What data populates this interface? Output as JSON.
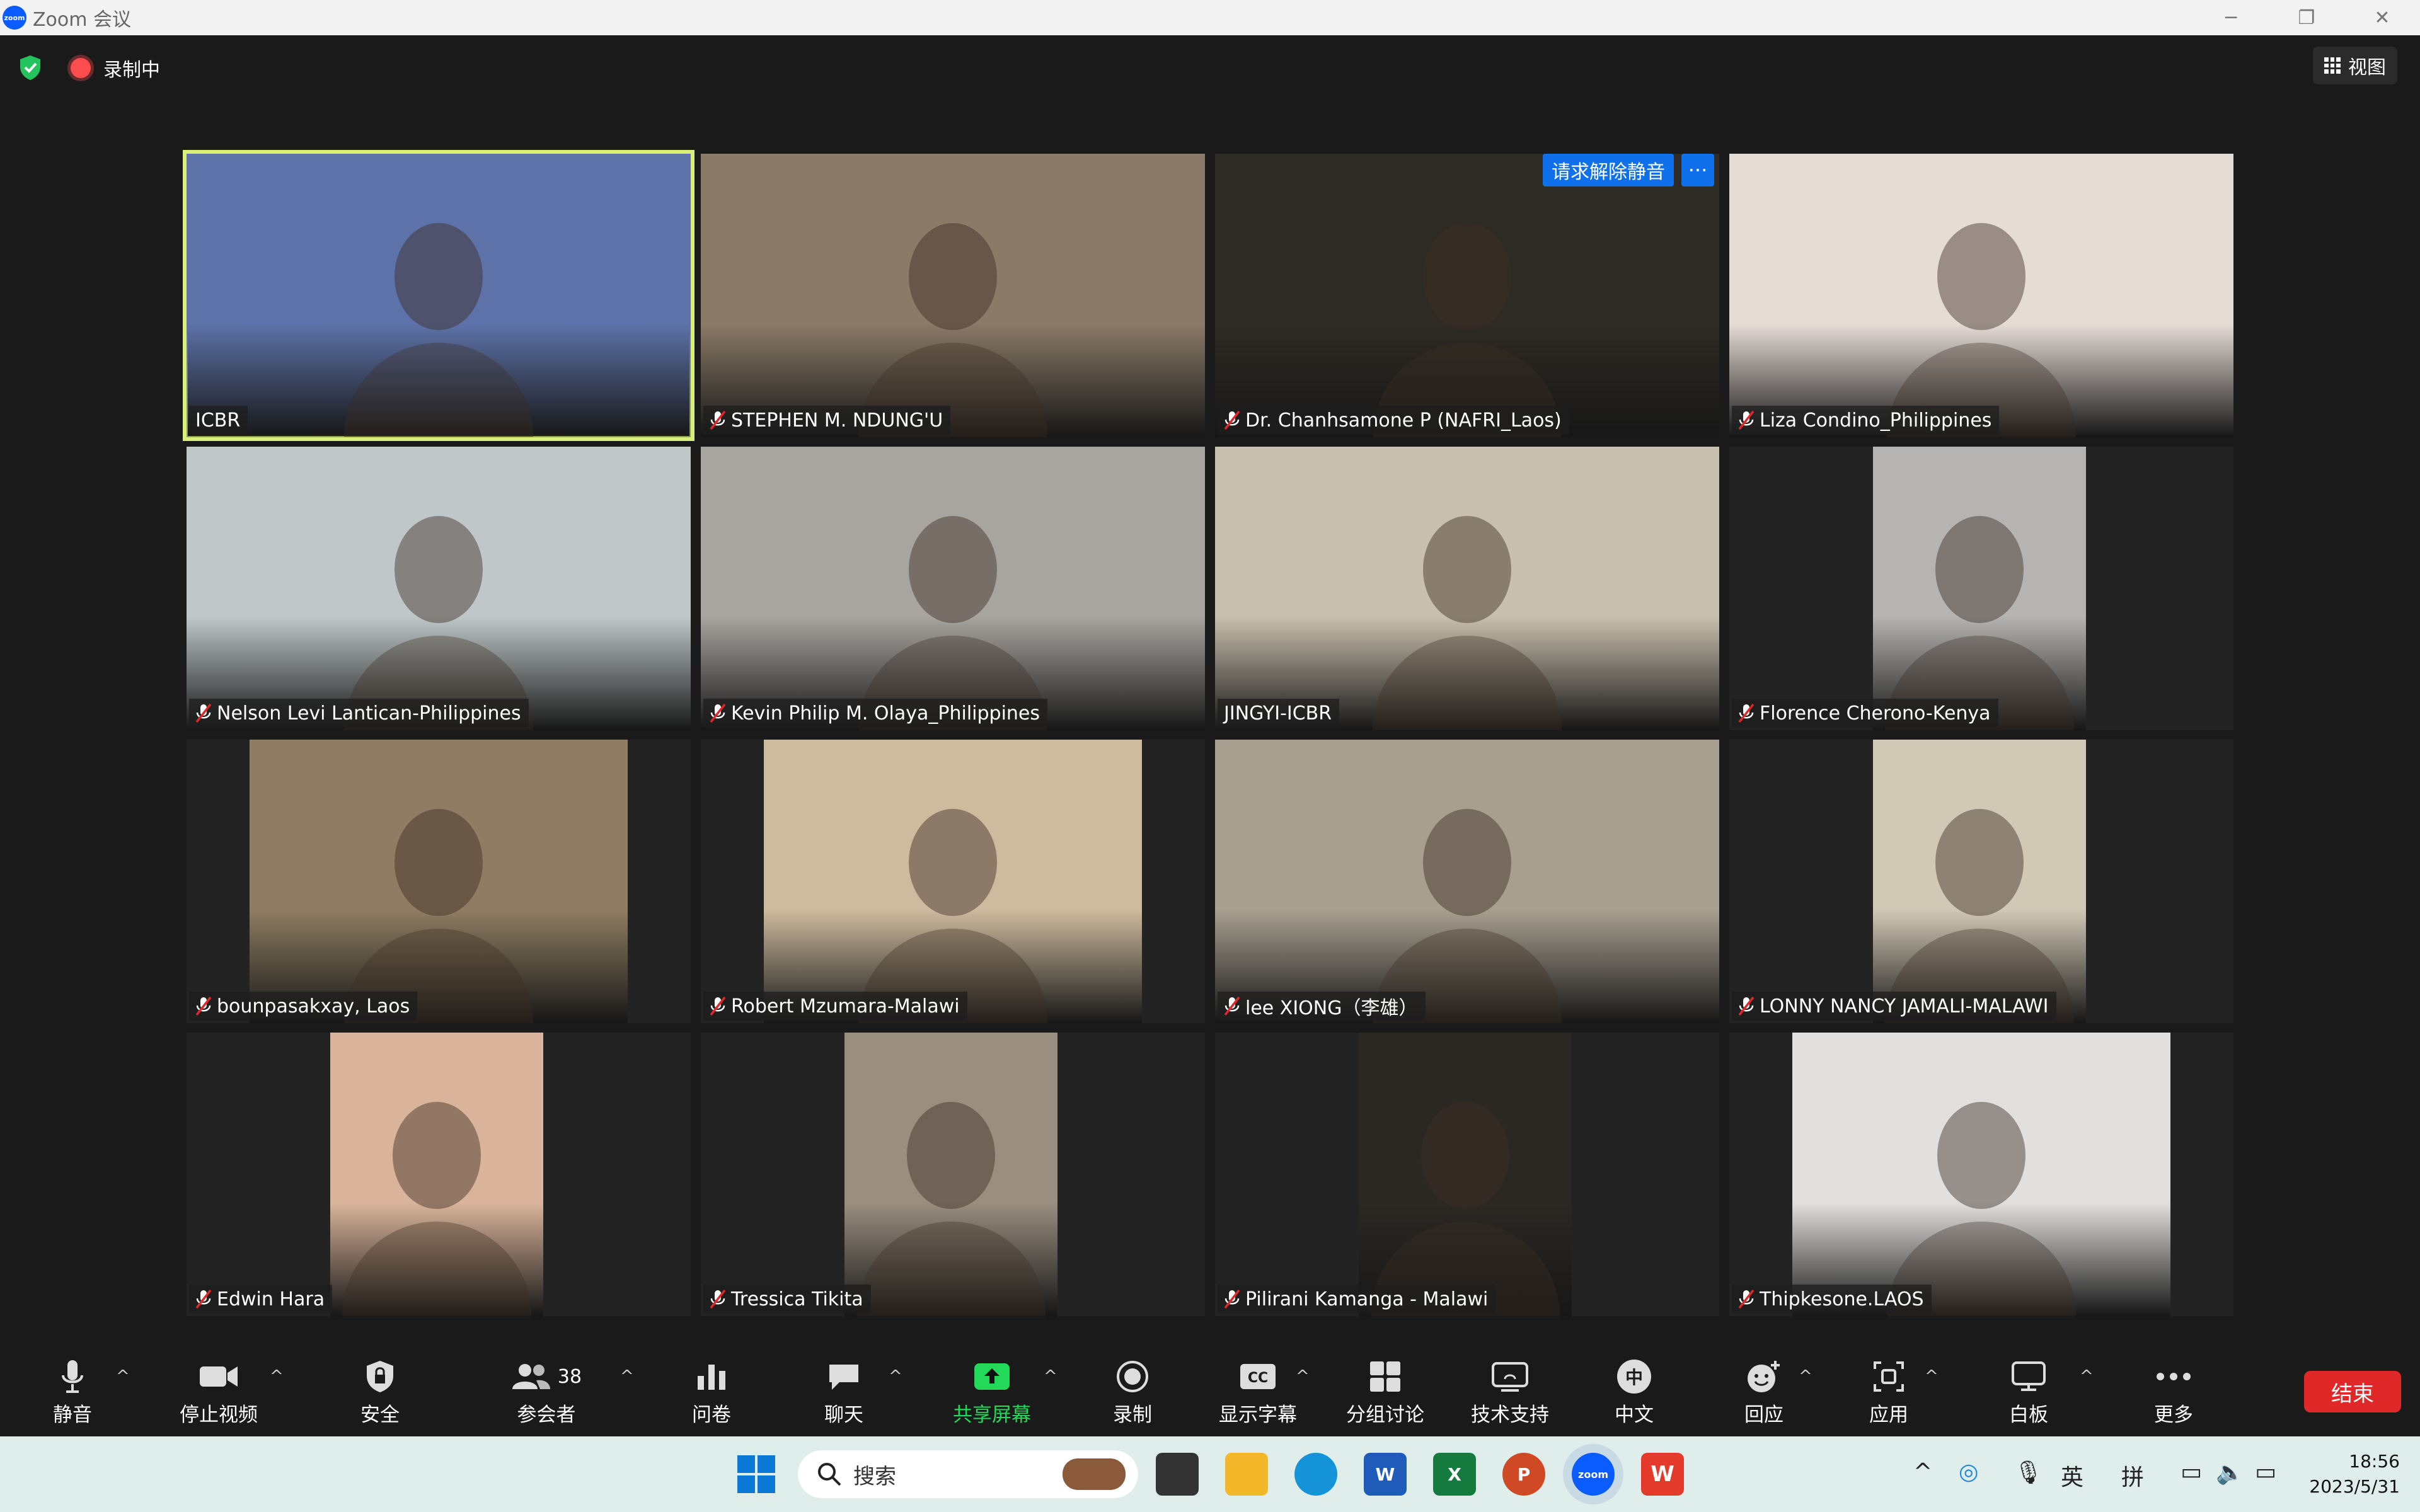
{
  "window": {
    "title": "Zoom 会议",
    "app_icon_text": "zoom",
    "controls": [
      "─",
      "❐",
      "✕"
    ]
  },
  "topbar": {
    "recording_label": "录制中",
    "view_label": "视图"
  },
  "request_unmute": {
    "label": "请求解除静音",
    "more": "···"
  },
  "participants": [
    {
      "name": "ICBR",
      "muted": false,
      "active": true,
      "bg": "#5d72a8"
    },
    {
      "name": "STEPHEN M. NDUNG'U",
      "muted": true,
      "bg": "#8a7a68"
    },
    {
      "name": "Dr. Chanhsamone P (NAFRI_Laos)",
      "muted": true,
      "bg": "#2e2a24"
    },
    {
      "name": "Liza Condino_Philippines",
      "muted": true,
      "bg": "#e6dcd6"
    },
    {
      "name": "Nelson Levi Lantican-Philippines",
      "muted": true,
      "bg": "#bfc7c8"
    },
    {
      "name": "Kevin Philip M. Olaya_Philippines",
      "muted": true,
      "bg": "#a8a4a0"
    },
    {
      "name": "JINGYI-ICBR",
      "muted": false,
      "bg": "#c9bfae"
    },
    {
      "name": "Florence Cherono-Kenya",
      "muted": true,
      "bg": "#b6b4b2"
    },
    {
      "name": "bounpasakxay, Laos",
      "muted": true,
      "bg": "#8e7d62"
    },
    {
      "name": "Robert Mzumara-Malawi",
      "muted": true,
      "bg": "#cdbb9e"
    },
    {
      "name": "lee XIONG（李雄）",
      "muted": true,
      "bg": "#a89f90"
    },
    {
      "name": "LONNY NANCY JAMALI-MALAWI",
      "muted": true,
      "bg": "#d2c8b6"
    },
    {
      "name": "Edwin Hara",
      "muted": true,
      "bg": "#d9b49a"
    },
    {
      "name": "Tressica Tikita",
      "muted": true,
      "bg": "#9a8e80"
    },
    {
      "name": "Pilirani Kamanga - Malawi",
      "muted": true,
      "bg": "#2b2824"
    },
    {
      "name": "Thipkesone.LAOS",
      "muted": true,
      "bg": "#e2e0de"
    }
  ],
  "toolbar": {
    "mute": "静音",
    "stop_video": "停止视频",
    "security": "安全",
    "participants": "参会者",
    "participants_count": "38",
    "polls": "问卷",
    "chat": "聊天",
    "share_screen": "共享屏幕",
    "record": "录制",
    "captions": "显示字幕",
    "breakout": "分组讨论",
    "support": "技术支持",
    "language": "中文",
    "language_icon": "中",
    "reactions": "回应",
    "apps": "应用",
    "whiteboard": "白板",
    "more": "更多",
    "end": "结束",
    "cc_icon": "CC"
  },
  "taskbar": {
    "search_placeholder": "搜索",
    "ime_lang": "英",
    "ime_mode": "拼",
    "time": "18:56",
    "date": "2023/5/31",
    "apps": [
      "W",
      "X",
      "P",
      "zoom",
      "W"
    ]
  },
  "colors": {
    "active_speaker": "#d8f07a",
    "share_green": "#23d959",
    "end_red": "#e02828",
    "zoom_blue": "#0e71eb"
  }
}
